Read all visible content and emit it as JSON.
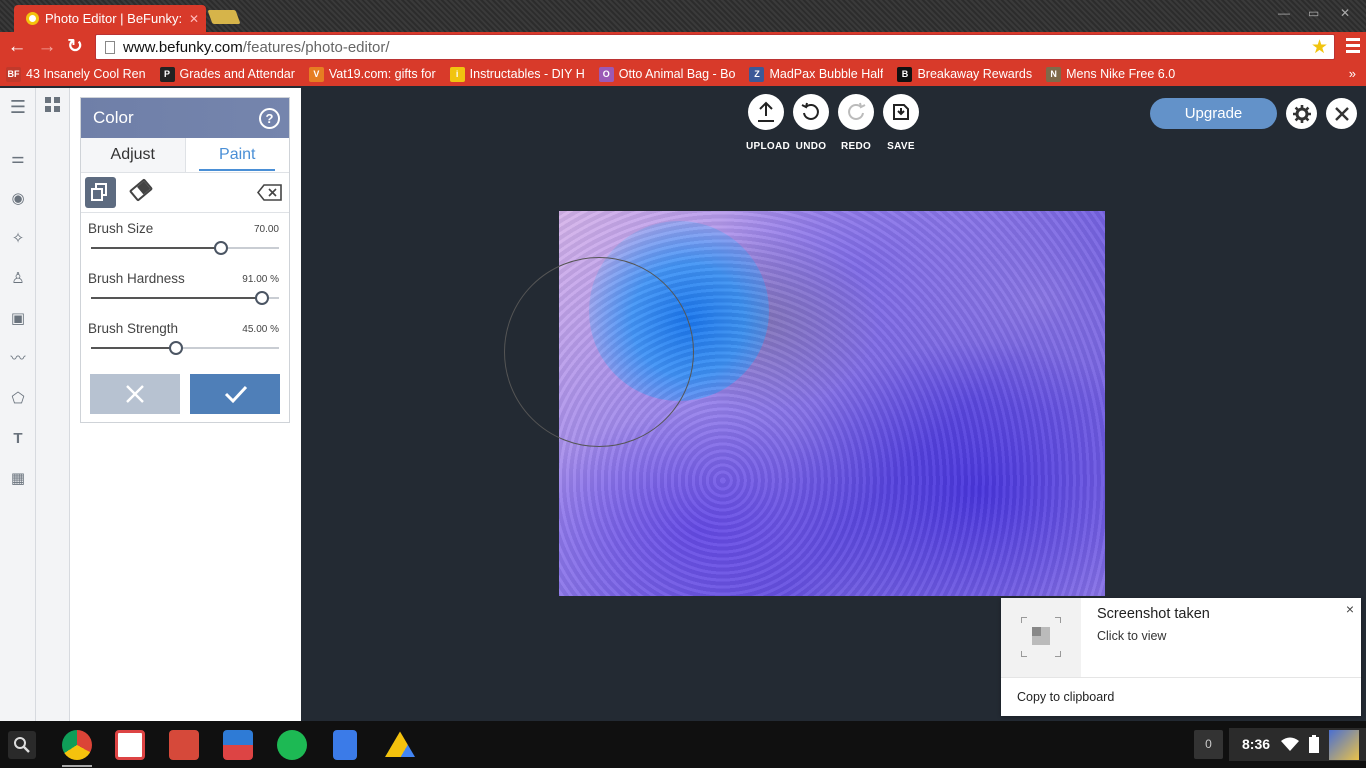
{
  "browser": {
    "tab_title": "Photo Editor | BeFunky: F",
    "url_host": "www.befunky.com",
    "url_path": "/features/photo-editor/",
    "bookmarks": [
      {
        "icon": "befunky-icon",
        "label": "43 Insanely Cool Ren",
        "color": "#c0392b",
        "glyph": "BF"
      },
      {
        "icon": "p-logo-icon",
        "label": "Grades and Attendar",
        "color": "#222222",
        "glyph": "P"
      },
      {
        "icon": "vat19-icon",
        "label": "Vat19.com: gifts for",
        "color": "#e67e22",
        "glyph": "V"
      },
      {
        "icon": "instructables-icon",
        "label": "Instructables - DIY H",
        "color": "#f1c40f",
        "glyph": "i"
      },
      {
        "icon": "cart-icon",
        "label": "Otto Animal Bag - Bo",
        "color": "#9b59b6",
        "glyph": "O"
      },
      {
        "icon": "madpax-icon",
        "label": "MadPax Bubble Half",
        "color": "#3b5998",
        "glyph": "Z"
      },
      {
        "icon": "breakaway-icon",
        "label": "Breakaway Rewards",
        "color": "#111111",
        "glyph": "B"
      },
      {
        "icon": "nike-icon",
        "label": "Mens Nike Free 6.0",
        "color": "#7f6a4a",
        "glyph": "N"
      }
    ],
    "bookmarks_more": "»"
  },
  "panel": {
    "title": "Color",
    "help": "?",
    "tabs": [
      {
        "label": "Adjust"
      },
      {
        "label": "Paint",
        "active": true
      }
    ],
    "sliders": [
      {
        "label": "Brush Size",
        "value_text": "70.00",
        "fraction": 0.69
      },
      {
        "label": "Brush Hardness",
        "value_text": "91.00 %",
        "fraction": 0.91
      },
      {
        "label": "Brush Strength",
        "value_text": "45.00 %",
        "fraction": 0.45
      }
    ]
  },
  "actions": [
    {
      "label": "UPLOAD",
      "icon": "upload-icon"
    },
    {
      "label": "UNDO",
      "icon": "undo-icon"
    },
    {
      "label": "REDO",
      "icon": "redo-icon"
    },
    {
      "label": "SAVE",
      "icon": "save-icon"
    }
  ],
  "upgrade_label": "Upgrade",
  "notification": {
    "title": "Screenshot taken",
    "subtitle": "Click to view",
    "button": "Copy to clipboard",
    "close": "×"
  },
  "shelf": {
    "notification_count": "0",
    "clock": "8:36"
  },
  "colors": {
    "chrome_red": "#d83a2a",
    "canvas_bg": "#232a33",
    "accent_blue": "#4a8fd6",
    "upgrade_blue": "#6392c9"
  }
}
